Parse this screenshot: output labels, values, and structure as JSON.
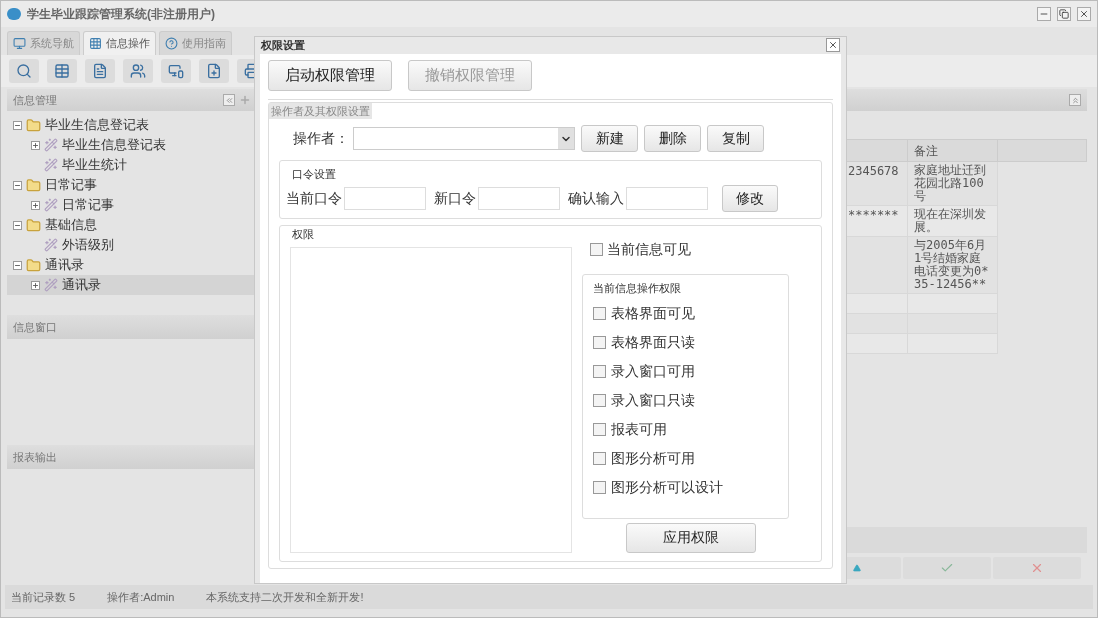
{
  "app": {
    "title": "学生毕业跟踪管理系统(非注册用户)"
  },
  "tabs": [
    {
      "label": "系统导航",
      "selected": false
    },
    {
      "label": "信息操作",
      "selected": true
    },
    {
      "label": "使用指南",
      "selected": false
    }
  ],
  "sidebar": {
    "panels": [
      {
        "title": "信息管理",
        "tree": [
          {
            "label": "毕业生信息登记表",
            "expanded": true,
            "selected": false,
            "children": [
              {
                "label": "毕业生信息登记表",
                "expanded": false,
                "selected": false
              },
              {
                "label": "毕业生统计",
                "selected": false
              }
            ]
          },
          {
            "label": "日常记事",
            "expanded": true,
            "selected": false,
            "children": [
              {
                "label": "日常记事",
                "expanded": false,
                "selected": false
              }
            ]
          },
          {
            "label": "基础信息",
            "expanded": true,
            "selected": false,
            "children": [
              {
                "label": "外语级别",
                "selected": false
              }
            ]
          },
          {
            "label": "通讯录",
            "expanded": true,
            "selected": false,
            "children": [
              {
                "label": "通讯录",
                "expanded": false,
                "selected": true
              }
            ]
          }
        ]
      },
      {
        "title": "信息窗口"
      },
      {
        "title": "报表输出"
      }
    ]
  },
  "table": {
    "columns": [
      "",
      "备注",
      ""
    ],
    "rows": [
      {
        "column_1": "2345678",
        "remark": "家庭地址迁到花园北路100号"
      },
      {
        "column_1": "*******",
        "remark": "现在在深圳发展。"
      },
      {
        "remark": "与2005年6月1号结婚家庭电话变更为0*35-12456**"
      },
      {},
      {},
      {}
    ]
  },
  "status_bar": [
    "当前记录数 5",
    "操作者:Admin",
    "本系统支持二次开发和全新开发!"
  ],
  "dialog": {
    "title": "权限设置",
    "buttons": [
      {
        "label": "启动权限管理",
        "disabled": false
      },
      {
        "label": "撤销权限管理",
        "disabled": true
      }
    ],
    "operator_group": {
      "title": "操作者及其权限设置",
      "operator_label": "操作者：",
      "buttons": [
        "新建",
        "删除",
        "复制"
      ]
    },
    "password_group": {
      "title": "口令设置",
      "fields": [
        {
          "label": "当前口令"
        },
        {
          "label": "新口令"
        },
        {
          "label": "确认输入"
        }
      ],
      "button": "修改"
    },
    "permissions_group": {
      "title": "权限",
      "current_visible": {
        "label": "当前信息可见",
        "checked": false
      },
      "ops_group": {
        "title": "当前信息操作权限",
        "options": [
          {
            "label": "表格界面可见",
            "checked": false
          },
          {
            "label": "表格界面只读",
            "checked": false
          },
          {
            "label": "录入窗口可用",
            "checked": false
          },
          {
            "label": "录入窗口只读",
            "checked": false
          },
          {
            "label": "报表可用",
            "checked": false
          },
          {
            "label": "图形分析可用",
            "checked": false
          },
          {
            "label": "图形分析可以设计",
            "checked": false
          }
        ]
      },
      "apply_button": "应用权限"
    }
  }
}
